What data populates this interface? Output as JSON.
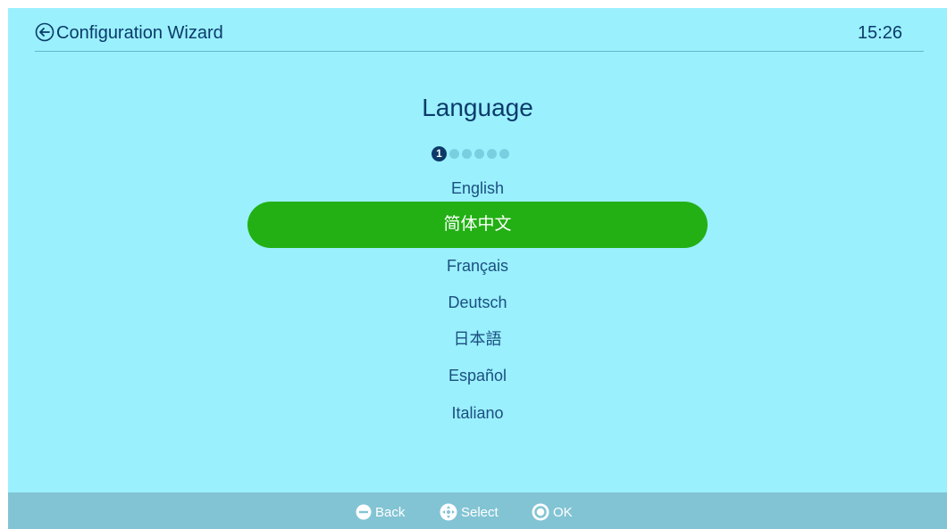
{
  "header": {
    "title": "Configuration Wizard",
    "time": "15:26"
  },
  "page": {
    "title": "Language"
  },
  "steps": {
    "current": "1",
    "total": 6
  },
  "languages": [
    {
      "label": "English"
    },
    {
      "label": "简体中文",
      "selected": true
    },
    {
      "label": "Français"
    },
    {
      "label": "Deutsch"
    },
    {
      "label": "日本語"
    },
    {
      "label": "Español"
    },
    {
      "label": "Italiano"
    }
  ],
  "footer": {
    "back_label": "Back",
    "select_label": "Select",
    "ok_label": "OK"
  },
  "colors": {
    "background": "#9af0fd",
    "selected": "#22b014",
    "footer": "#82c4d4",
    "text": "#1b4f80"
  }
}
